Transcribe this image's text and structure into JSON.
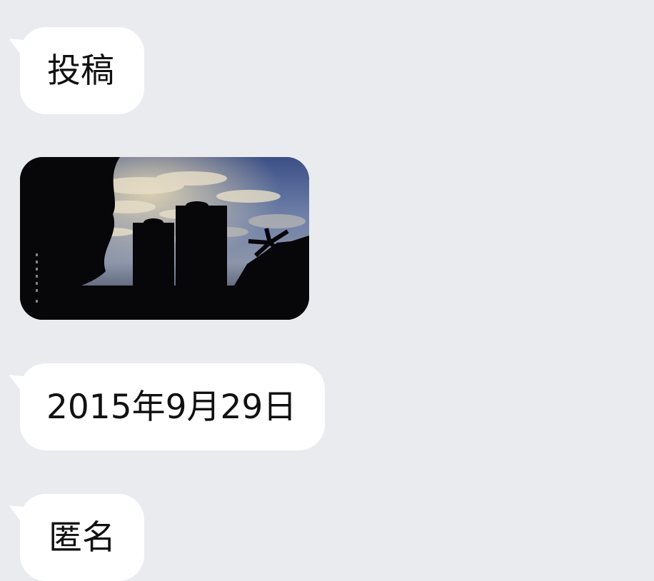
{
  "chat": {
    "messages": [
      {
        "type": "text",
        "text": "投稿"
      },
      {
        "type": "image",
        "image_label": "city-skyline-silhouette-photo"
      },
      {
        "type": "text",
        "text": "2015年9月29日"
      },
      {
        "type": "text",
        "text": "匿名"
      }
    ]
  },
  "colors": {
    "background": "#eaebef",
    "bubble": "#ffffff",
    "text": "#111111"
  }
}
